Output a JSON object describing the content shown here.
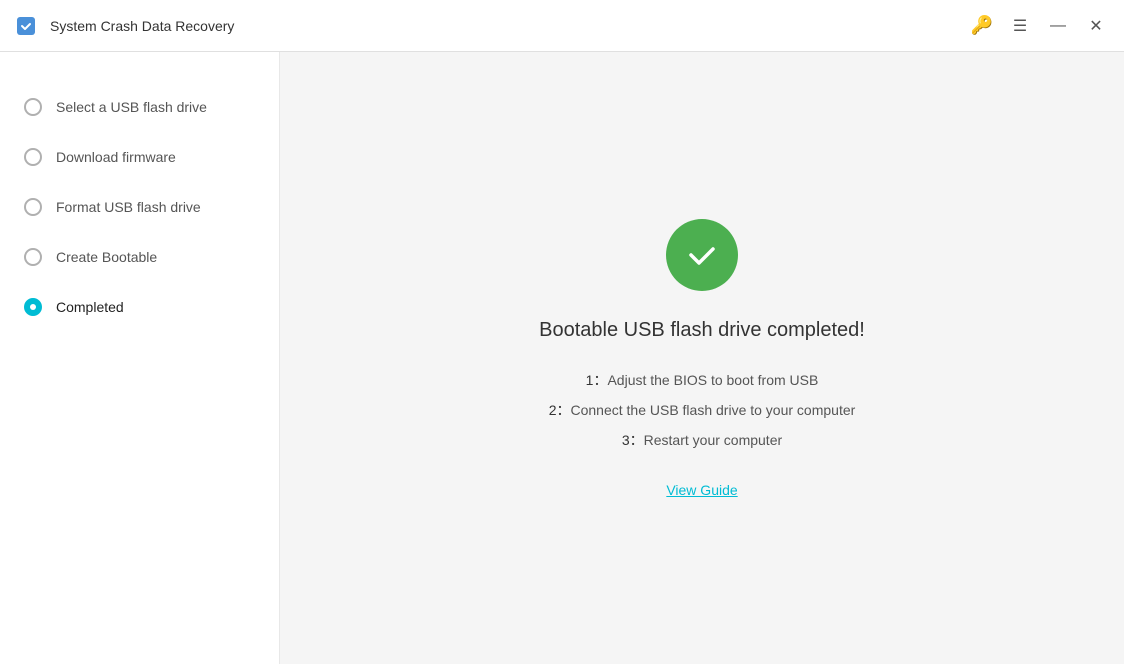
{
  "titlebar": {
    "title": "System Crash Data Recovery",
    "key_icon": "🔑",
    "menu_icon": "☰",
    "minimize_icon": "—",
    "close_icon": "✕"
  },
  "sidebar": {
    "items": [
      {
        "id": "select-usb",
        "label": "Select a USB flash drive",
        "state": "inactive"
      },
      {
        "id": "download-firmware",
        "label": "Download firmware",
        "state": "inactive"
      },
      {
        "id": "format-usb",
        "label": "Format USB flash drive",
        "state": "inactive"
      },
      {
        "id": "create-bootable",
        "label": "Create Bootable",
        "state": "inactive"
      },
      {
        "id": "completed",
        "label": "Completed",
        "state": "active"
      }
    ]
  },
  "content": {
    "completion_title": "Bootable USB flash drive completed!",
    "steps": [
      {
        "num": "1：",
        "text": "Adjust the BIOS to boot from USB"
      },
      {
        "num": "2：",
        "text": "Connect the USB flash drive to your computer"
      },
      {
        "num": "3：",
        "text": "Restart your computer"
      }
    ],
    "view_guide_label": "View Guide"
  }
}
